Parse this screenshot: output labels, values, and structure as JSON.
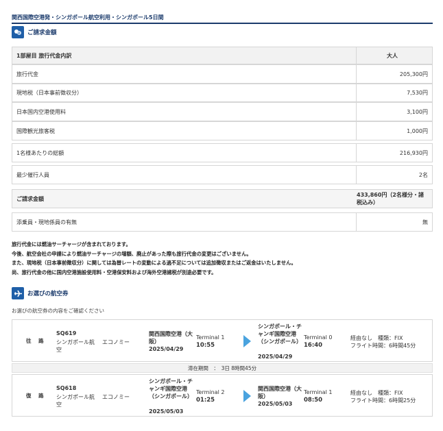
{
  "page": {
    "title": "関西国際空港発・シンガポール航空利用・シンガポール5日間"
  },
  "billing": {
    "section_title": "ご請求金額",
    "header_label": "1部屋目 旅行代金内訳",
    "header_col": "大人",
    "rows": [
      {
        "label": "旅行代金",
        "value": "205,300円"
      },
      {
        "label": "現地税（日本事前徴収分）",
        "value": "7,530円"
      },
      {
        "label": "日本国内空港使用料",
        "value": "3,100円"
      },
      {
        "label": "国際観光旅客税",
        "value": "1,000円"
      },
      {
        "label": "1名様あたりの総額",
        "value": "216,930円"
      },
      {
        "label": "最少催行人員",
        "value": "2名"
      },
      {
        "label": "ご請求金額",
        "value": "433,860円（2名様分・諸税込み）"
      },
      {
        "label": "添乗員・現地係員の有無",
        "value": "無"
      }
    ]
  },
  "notes": [
    "旅行代金には燃油サーチャージが含まれております。",
    "今後、航空会社の申請により燃油サーチャージの増額、廃止があった際も旅行代金の変更はございません。",
    "また、現地税（日本事前徴収分）に関しては為替レートの変動による過不足については追加徴収またはご返金はいたしません。",
    "尚、旅行代金の他に国内空港施設使用料・空港保安料および海外空港諸税が別途必要です。"
  ],
  "flights": {
    "section_title": "お選びの航空券",
    "subnote": "お選びの航空券の内容をご確認ください",
    "outbound": {
      "direction": "往 路",
      "flight_no": "SQ619",
      "airline": "シンガポール航空",
      "cabin": "エコノミー",
      "dep_airport": "関西国際空港（大阪）",
      "dep_date": "2025/04/29",
      "dep_terminal": "Terminal 1",
      "dep_time": "10:55",
      "arr_airport": "シンガポール・チャンギ国際空港（シンガポール）",
      "arr_date": "2025/04/29",
      "arr_terminal": "Terminal 0",
      "arr_time": "16:40",
      "stops": "経由なし　種類：FIX",
      "duration": "フライト時間：6時間45分"
    },
    "stay": "滞在期間　：　3日 8時間45分",
    "inbound": {
      "direction": "復 路",
      "flight_no": "SQ618",
      "airline": "シンガポール航空",
      "cabin": "エコノミー",
      "dep_airport": "シンガポール・チャンギ国際空港（シンガポール）",
      "dep_date": "2025/05/03",
      "dep_terminal": "Terminal 2",
      "dep_time": "01:25",
      "arr_airport": "関西国際空港（大阪）",
      "arr_date": "2025/05/03",
      "arr_terminal": "Terminal 1",
      "arr_time": "08:50",
      "stops": "経由なし　種類：FIX",
      "duration": "フライト時間：6時間25分"
    }
  },
  "colors": {
    "brand": "#1a3a6b",
    "icon_bg": "#1f5fa8",
    "arrow": "#4aa3df"
  }
}
